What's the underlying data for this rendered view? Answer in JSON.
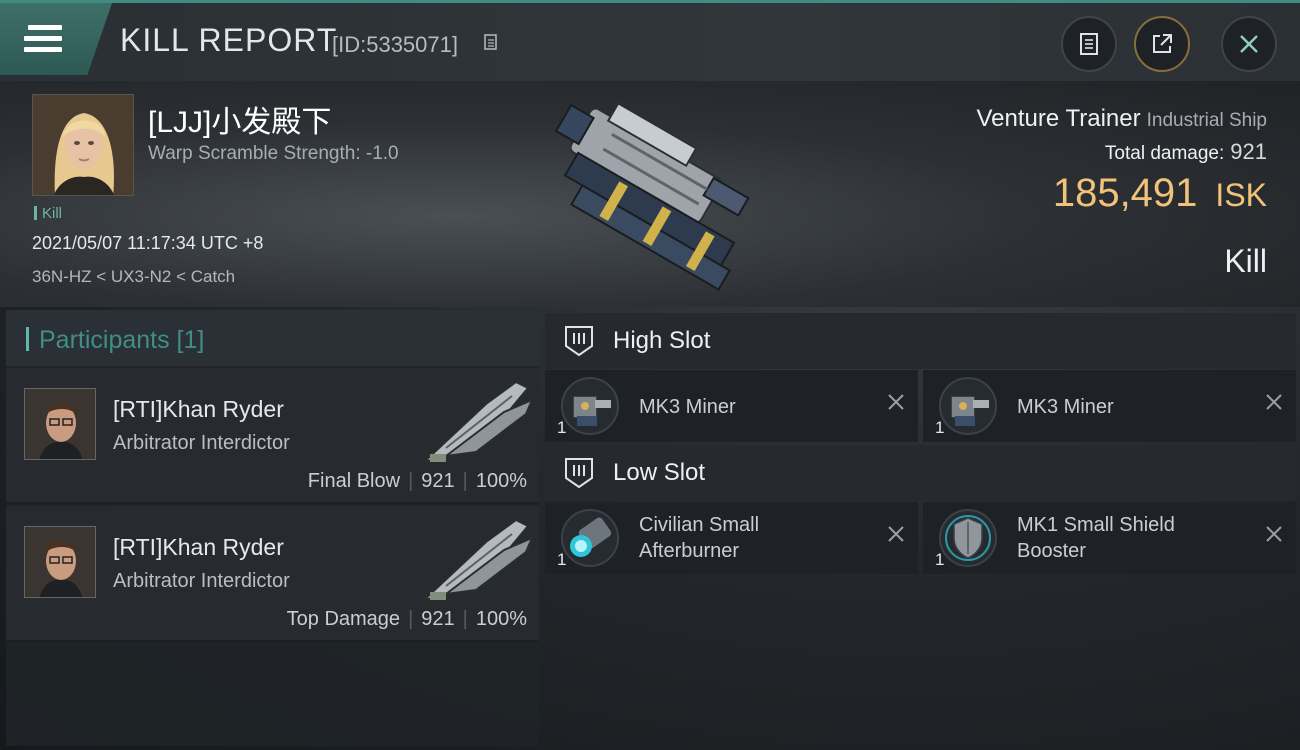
{
  "header": {
    "title": "KILL REPORT",
    "report_id": "[ID:5335071]"
  },
  "victim": {
    "name": "[LJJ]小发殿下",
    "warp_scramble": "Warp Scramble Strength: -1.0",
    "kill_tag": "Kill",
    "timestamp": "2021/05/07 11:17:34 UTC +8",
    "location": "36N-HZ < UX3-N2 < Catch",
    "ship_name": "Venture Trainer",
    "ship_class": "Industrial Ship",
    "total_damage_label": "Total damage:",
    "total_damage": "921",
    "isk_value": "185,491",
    "isk_unit": "ISK",
    "result": "Kill"
  },
  "participants": {
    "title": "Participants [1]",
    "rows": [
      {
        "name": "[RTI]Khan Ryder",
        "ship": "Arbitrator Interdictor",
        "role": "Final Blow",
        "damage": "921",
        "percent": "100%"
      },
      {
        "name": "[RTI]Khan Ryder",
        "ship": "Arbitrator Interdictor",
        "role": "Top Damage",
        "damage": "921",
        "percent": "100%"
      }
    ],
    "separator": "|"
  },
  "slots": {
    "high": {
      "title": "High Slot",
      "modules": [
        {
          "name": "MK3 Miner",
          "qty": "1"
        },
        {
          "name": "MK3 Miner",
          "qty": "1"
        }
      ]
    },
    "low": {
      "title": "Low Slot",
      "modules": [
        {
          "name_line1": "Civilian Small",
          "name_line2": "Afterburner",
          "qty": "1"
        },
        {
          "name_line1": "MK1 Small Shield",
          "name_line2": "Booster",
          "qty": "1"
        }
      ]
    }
  },
  "colors": {
    "accent": "#3d8d83",
    "isk": "#f2c27a"
  },
  "icons": [
    "menu-icon",
    "copy-icon",
    "clipboard-icon",
    "share-icon",
    "close-icon",
    "slot-icon",
    "remove-icon"
  ]
}
